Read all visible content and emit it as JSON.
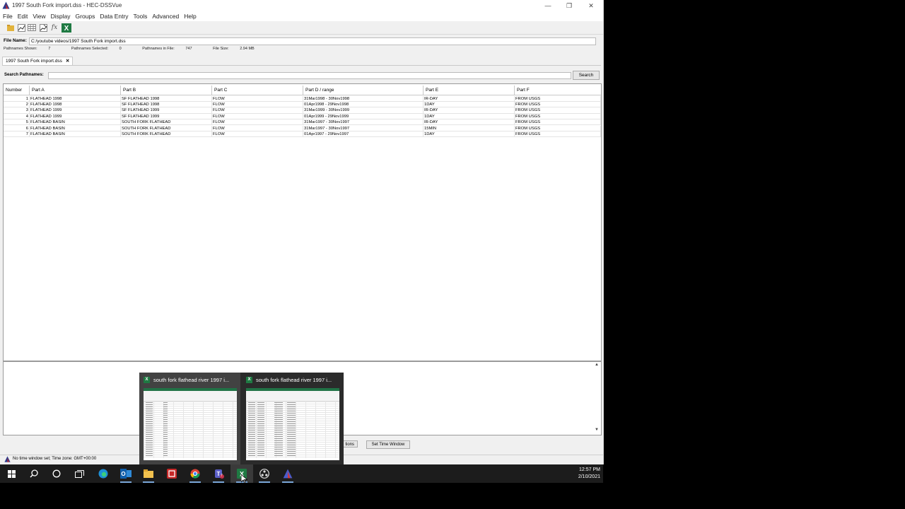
{
  "window": {
    "title": "1997 South Fork import.dss - HEC-DSSVue",
    "minimize": "—",
    "restore": "❐",
    "close": "✕"
  },
  "menu": [
    "File",
    "Edit",
    "View",
    "Display",
    "Groups",
    "Data Entry",
    "Tools",
    "Advanced",
    "Help"
  ],
  "file": {
    "name_label": "File Name:",
    "name_value": "C:/youtube videos/1997 South Fork import.dss",
    "shown_label": "Pathnames Shown:",
    "shown_value": "7",
    "selected_label": "Pathnames Selected:",
    "selected_value": "0",
    "infile_label": "Pathnames in File:",
    "infile_value": "747",
    "size_label": "File Size:",
    "size_value": "2.94  MB"
  },
  "tab": {
    "label": "1997 South Fork import.dss",
    "close": "✕"
  },
  "search": {
    "label": "Search Pathnames:",
    "button": "Search",
    "value": ""
  },
  "table": {
    "headers": [
      "Number",
      "Part A",
      "Part B",
      "Part C",
      "Part D / range",
      "Part E",
      "Part F"
    ],
    "rows": [
      [
        "1",
        "FLATHEAD 1998",
        "SF FLATHEAD 1998",
        "FLOW",
        "31Mar1998 - 30Nov1998",
        "IR-DAY",
        "FROM USGS"
      ],
      [
        "2",
        "FLATHEAD 1998",
        "SF FLATHEAD 1998",
        "FLOW",
        "01Apr1998 - 29Nov1998",
        "1DAY",
        "FROM USGS"
      ],
      [
        "3",
        "FLATHEAD 1999",
        "SF FLATHEAD 1999",
        "FLOW",
        "31Mar1999 - 30Nov1999",
        "IR-DAY",
        "FROM USGS"
      ],
      [
        "4",
        "FLATHEAD 1999",
        "SF FLATHEAD 1999",
        "FLOW",
        "01Apr1999 - 29Nov1999",
        "1DAY",
        "FROM USGS"
      ],
      [
        "5",
        "FLATHEAD BASIN",
        "SOUTH FORK FLATHEAD",
        "FLOW",
        "31Mar1997 - 30Nov1997",
        "IR-DAY",
        "FROM USGS"
      ],
      [
        "6",
        "FLATHEAD BASIN",
        "SOUTH FORK FLATHEAD",
        "FLOW",
        "31Mar1997 - 30Nov1997",
        "15MIN",
        "FROM USGS"
      ],
      [
        "7",
        "FLATHEAD BASIN",
        "SOUTH FORK FLATHEAD",
        "FLOW",
        "01Apr1997 - 29Nov1997",
        "1DAY",
        "FROM USGS"
      ]
    ]
  },
  "bottom_buttons": {
    "options_partial": "tions",
    "set_time_window": "Set Time Window"
  },
  "status": {
    "message": "No time window set;  Time zone: GMT+00:00"
  },
  "taskbar": {
    "icons": [
      "windows-start-icon",
      "search-icon",
      "cortana-icon",
      "task-view-icon",
      "edge-icon",
      "outlook-icon",
      "file-explorer-icon",
      "app-red-icon",
      "chrome-icon",
      "teams-icon",
      "excel-icon",
      "obs-icon",
      "hec-dssvue-icon"
    ],
    "time": "12:57 PM",
    "date": "2/10/2021",
    "teams_badge": "7"
  },
  "preview": {
    "windows": [
      {
        "title": "south fork flathead river 1997 i..."
      },
      {
        "title": "south fork flathead river 1997 i..."
      }
    ]
  },
  "colors": {
    "excel_green": "#217346",
    "taskbar": "#1c1c1c"
  }
}
